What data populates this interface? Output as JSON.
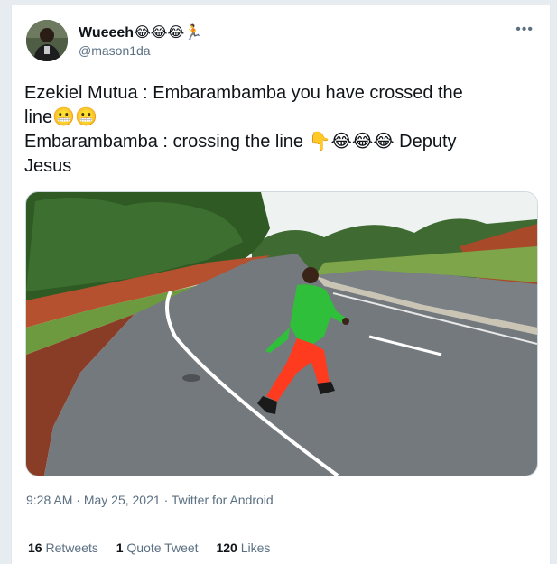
{
  "header": {
    "display_name": "Wueeeh",
    "name_emojis": "😂😂😂🏃",
    "handle": "@mason1da",
    "more_icon": "more-horizontal-icon"
  },
  "tweet": {
    "line1": "Ezekiel Mutua : Embarambamba you have crossed the",
    "line2": "line😬😬",
    "line3": "Embarambamba : crossing the line 👇😂😂😂 Deputy",
    "line4": "Jesus"
  },
  "meta": {
    "time": "9:28 AM",
    "date": "May 25, 2021",
    "source": "Twitter for Android"
  },
  "stats": {
    "retweets_count": "16",
    "retweets_label": "Retweets",
    "quotes_count": "1",
    "quotes_label": "Quote Tweet",
    "likes_count": "120",
    "likes_label": "Likes"
  },
  "colors": {
    "text": "#0f1419",
    "secondary": "#5b7083",
    "divider": "#e6ecf0",
    "jacket": "#2fbf3a",
    "trousers": "#ff3b1f",
    "road": "#6f7478"
  }
}
